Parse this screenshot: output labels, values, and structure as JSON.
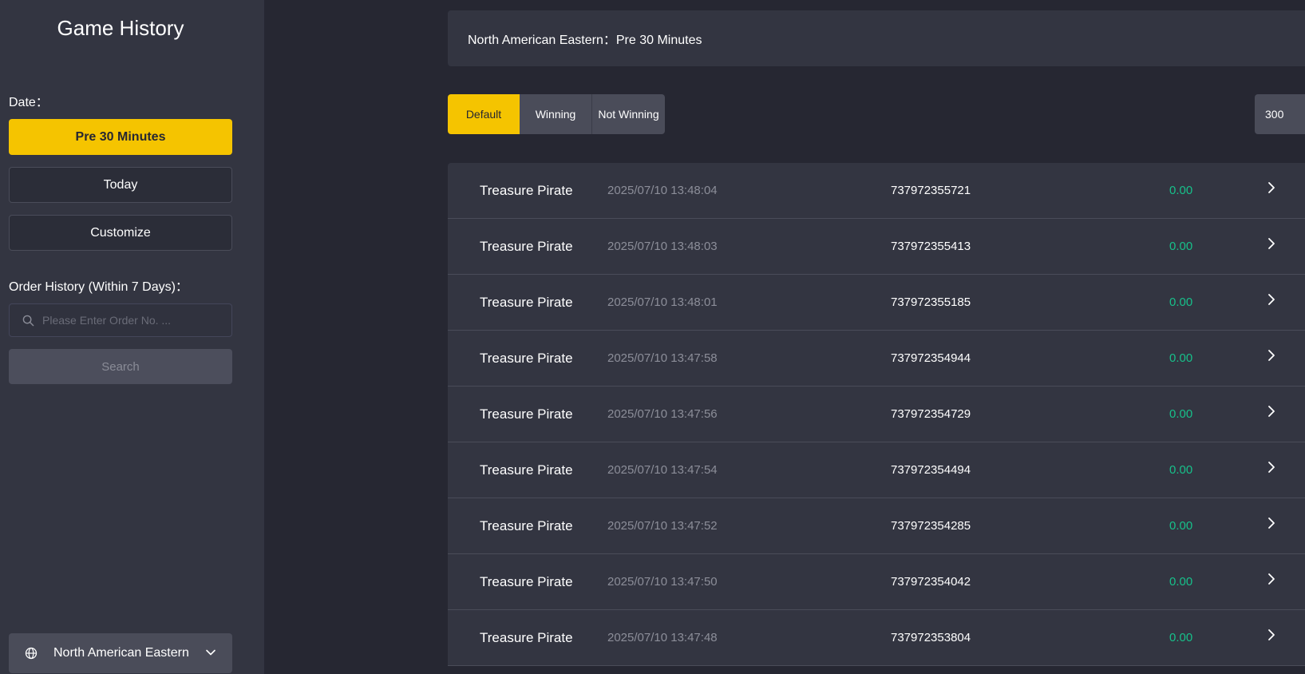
{
  "sidebar": {
    "title": "Game History",
    "date_label": "Date：",
    "date_options": {
      "pre30": "Pre 30 Minutes",
      "today": "Today",
      "customize": "Customize"
    },
    "order_label": "Order History (Within 7 Days)：",
    "search_placeholder": "Please Enter Order No. ...",
    "search_button": "Search",
    "timezone": "North American Eastern"
  },
  "header": {
    "text": "North American Eastern：Pre 30 Minutes"
  },
  "filters": {
    "default": "Default",
    "winning": "Winning",
    "not_winning": "Not Winning"
  },
  "page_size": "300",
  "colors": {
    "accent": "#f5c400",
    "win_amount": "#17c08a",
    "panel": "#333541",
    "background": "#262732"
  },
  "records": [
    {
      "game": "Treasure Pirate",
      "time": "2025/07/10 13:48:04",
      "order": "737972355721",
      "amount": "0.00"
    },
    {
      "game": "Treasure Pirate",
      "time": "2025/07/10 13:48:03",
      "order": "737972355413",
      "amount": "0.00"
    },
    {
      "game": "Treasure Pirate",
      "time": "2025/07/10 13:48:01",
      "order": "737972355185",
      "amount": "0.00"
    },
    {
      "game": "Treasure Pirate",
      "time": "2025/07/10 13:47:58",
      "order": "737972354944",
      "amount": "0.00"
    },
    {
      "game": "Treasure Pirate",
      "time": "2025/07/10 13:47:56",
      "order": "737972354729",
      "amount": "0.00"
    },
    {
      "game": "Treasure Pirate",
      "time": "2025/07/10 13:47:54",
      "order": "737972354494",
      "amount": "0.00"
    },
    {
      "game": "Treasure Pirate",
      "time": "2025/07/10 13:47:52",
      "order": "737972354285",
      "amount": "0.00"
    },
    {
      "game": "Treasure Pirate",
      "time": "2025/07/10 13:47:50",
      "order": "737972354042",
      "amount": "0.00"
    },
    {
      "game": "Treasure Pirate",
      "time": "2025/07/10 13:47:48",
      "order": "737972353804",
      "amount": "0.00"
    }
  ]
}
